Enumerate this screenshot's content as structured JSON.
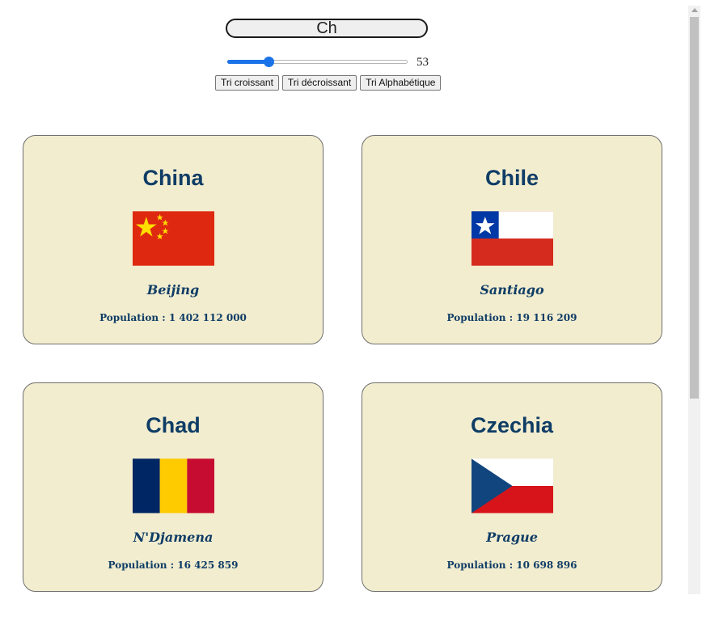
{
  "search": {
    "value": "Ch"
  },
  "slider": {
    "value": "53",
    "fraction": 0.23
  },
  "sort_buttons": {
    "asc_label": "Tri croissant",
    "desc_label": "Tri décroissant",
    "alpha_label": "Tri Alphabétique"
  },
  "countries": [
    {
      "name": "China",
      "capital": "Beijing",
      "population": "Population : 1 402 112 000",
      "flag": "china-flag"
    },
    {
      "name": "Chile",
      "capital": "Santiago",
      "population": "Population : 19 116 209",
      "flag": "chile-flag"
    },
    {
      "name": "Chad",
      "capital": "N'Djamena",
      "population": "Population : 16 425 859",
      "flag": "chad-flag"
    },
    {
      "name": "Czechia",
      "capital": "Prague",
      "population": "Population : 10 698 896",
      "flag": "czechia-flag"
    }
  ],
  "colors": {
    "card_bg": "#f2edcf",
    "text_accent": "#0f3d66",
    "slider_accent": "#1a73e8"
  }
}
